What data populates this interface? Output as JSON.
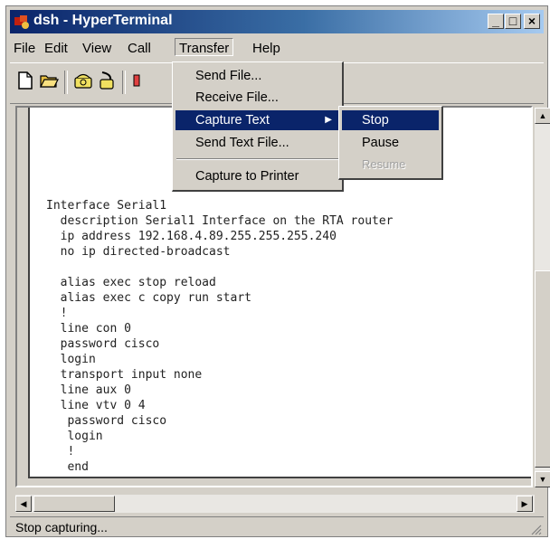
{
  "window": {
    "title": "dsh - HyperTerminal"
  },
  "controls": {
    "minimize": "_",
    "maximize": "□",
    "close": "×"
  },
  "menubar": {
    "file": "File",
    "edit": "Edit",
    "view": "View",
    "call": "Call",
    "transfer": "Transfer",
    "help": "Help"
  },
  "toolbar_icons": [
    "new-document-icon",
    "open-folder-icon",
    "connect-phone-icon",
    "disconnect-phone-icon",
    "send-icon"
  ],
  "transfer_menu": {
    "items": [
      "Send File...",
      "Receive File...",
      "Capture Text",
      "Send Text File...",
      "Capture to Printer"
    ]
  },
  "capture_submenu": {
    "items": [
      "Stop",
      "Pause",
      "Resume"
    ]
  },
  "terminal": {
    "lines": "Interface Serial1\n  description Serial1 Interface on the RTA router\n  ip address 192.168.4.89.255.255.255.240\n  no ip directed-broadcast\n\n  alias exec stop reload\n  alias exec c copy run start\n  !\n  line con 0\n  password cisco\n  login\n  transport input none\n  line aux 0\n  line vtv 0 4\n   password cisco\n   login\n   !\n   end"
  },
  "status": {
    "text": "Stop capturing..."
  },
  "colors": {
    "titlebar_start": "#0a246a",
    "titlebar_end": "#a6caf0",
    "highlight": "#0a246a",
    "face": "#d4d0c8"
  }
}
